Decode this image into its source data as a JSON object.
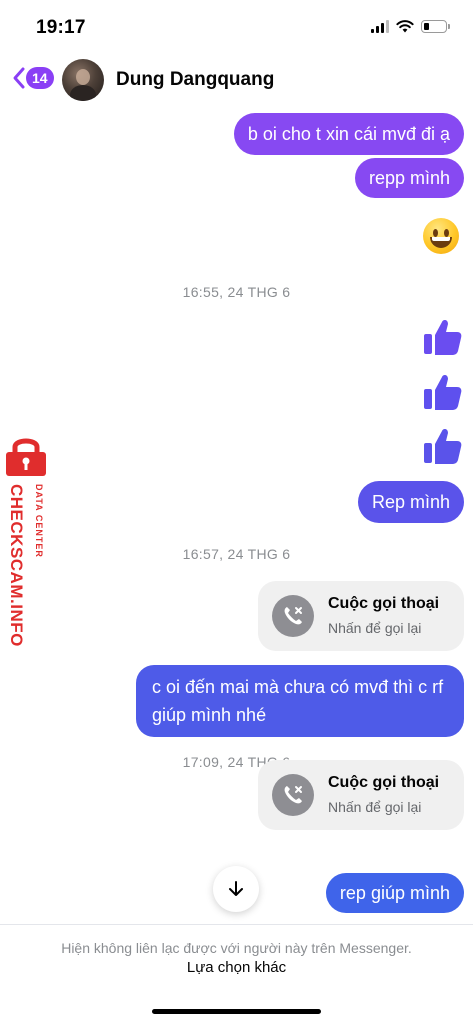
{
  "status_bar": {
    "time": "19:17",
    "battery_level": 0.2
  },
  "header": {
    "back_badge": "14",
    "contact_name": "Dung Dangquang"
  },
  "messages": {
    "m1": "b oi cho t xin cái mvđ đi ạ",
    "m2": "repp mình",
    "ts1": "16:55, 24 THG 6",
    "m3": "Rep mình",
    "ts2": "16:57, 24 THG 6",
    "m4": "c oi đến mai mà chưa có mvđ thì c rf giúp mình nhé",
    "ts3": "17:09, 24 THG 6",
    "m5": "rep giúp mình"
  },
  "call_cards": [
    {
      "title": "Cuộc gọi thoại",
      "subtitle": "Nhấn để gọi lại"
    },
    {
      "title": "Cuộc gọi thoại",
      "subtitle": "Nhấn để gọi lại"
    }
  ],
  "watermark": {
    "main": "CHECKSCAM.INFO",
    "sub": "DATA CENTER"
  },
  "footer": {
    "notice": "Hiện không liên lạc được với người này trên Messenger.",
    "link": "Lựa chọn khác"
  },
  "colors": {
    "accent_purple": "#8749f2",
    "like_blue": "#5a53ea",
    "bubble_blue": "#3f64ea",
    "watermark_red": "#e02d2d"
  }
}
